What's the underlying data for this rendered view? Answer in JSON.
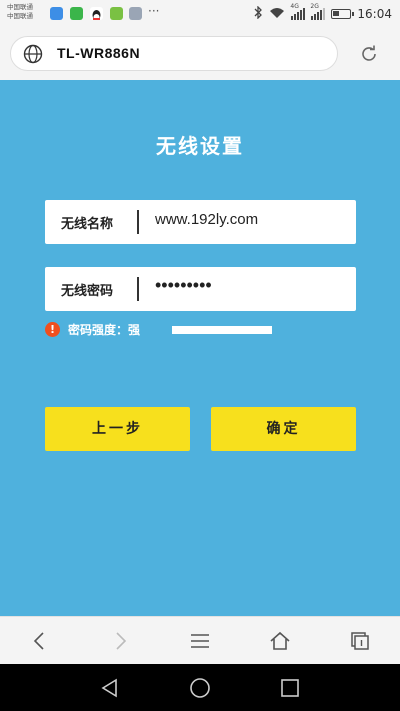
{
  "status_bar": {
    "carrier_line1": "中国联通",
    "carrier_line2": "中国联通",
    "network_4g": "4G",
    "network_2g": "2G",
    "overflow": "···",
    "time": "16:04"
  },
  "browser": {
    "url": "TL-WR886N"
  },
  "page": {
    "title": "无线设置",
    "ssid_label": "无线名称",
    "ssid_value": "www.192ly.com",
    "password_label": "无线密码",
    "password_value": "•••••••••",
    "strength_warning_icon": "!",
    "strength_text": "密码强度：强",
    "strength_level": 1.0,
    "prev_button": "上一步",
    "confirm_button": "确定"
  },
  "colors": {
    "background": "#4fb1dd",
    "button": "#f7e01d",
    "warning": "#f04f1e"
  }
}
